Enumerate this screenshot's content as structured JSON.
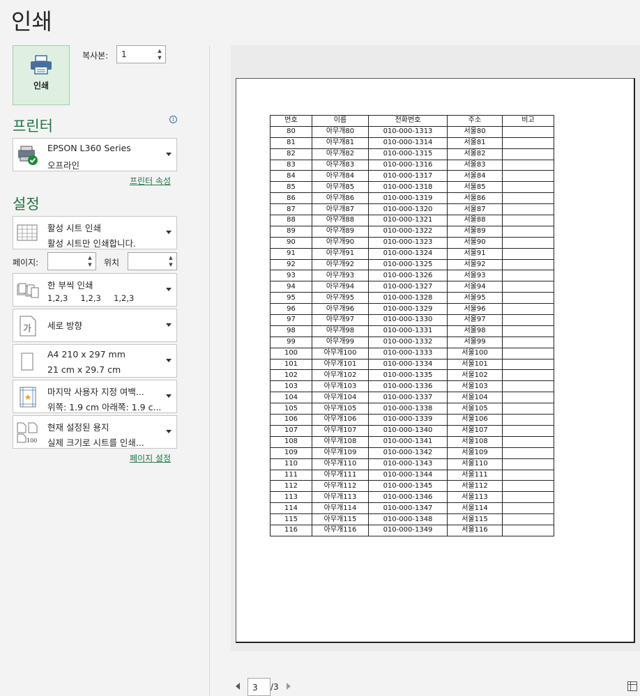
{
  "title": "인쇄",
  "print_button": {
    "label": "인쇄"
  },
  "copies": {
    "label": "복사본:",
    "value": "1"
  },
  "printer": {
    "heading": "프린터",
    "name": "EPSON L360 Series",
    "status": "오프라인",
    "properties_link": "프린터 속성"
  },
  "settings": {
    "heading": "설정",
    "scope": {
      "title": "활성 시트 인쇄",
      "desc": "활성 시트만 인쇄합니다."
    },
    "pages": {
      "label": "페이지:",
      "from": "",
      "to_label": "위치",
      "to": ""
    },
    "collate": {
      "title": "한 부씩 인쇄",
      "desc": "1,2,3     1,2,3     1,2,3"
    },
    "orientation": {
      "title": "세로 방향"
    },
    "paper": {
      "title": "A4 210 x 297 mm",
      "desc": "21 cm x 29.7 cm"
    },
    "margins": {
      "title": "마지막 사용자 지정 여백...",
      "desc": "위쪽: 1.9 cm 아래쪽: 1.9 c..."
    },
    "scaling": {
      "title": "현재 설정된 용지",
      "desc": "실제 크기로 시트를 인쇄..."
    },
    "page_setup_link": "페이지 설정"
  },
  "preview": {
    "columns": [
      "번호",
      "이름",
      "전화번호",
      "주소",
      "비고"
    ],
    "rows": [
      [
        "80",
        "아무개80",
        "010-000-1313",
        "서울80",
        ""
      ],
      [
        "81",
        "아무개81",
        "010-000-1314",
        "서울81",
        ""
      ],
      [
        "82",
        "아무개82",
        "010-000-1315",
        "서울82",
        ""
      ],
      [
        "83",
        "아무개83",
        "010-000-1316",
        "서울83",
        ""
      ],
      [
        "84",
        "아무개84",
        "010-000-1317",
        "서울84",
        ""
      ],
      [
        "85",
        "아무개85",
        "010-000-1318",
        "서울85",
        ""
      ],
      [
        "86",
        "아무개86",
        "010-000-1319",
        "서울86",
        ""
      ],
      [
        "87",
        "아무개87",
        "010-000-1320",
        "서울87",
        ""
      ],
      [
        "88",
        "아무개88",
        "010-000-1321",
        "서울88",
        ""
      ],
      [
        "89",
        "아무개89",
        "010-000-1322",
        "서울89",
        ""
      ],
      [
        "90",
        "아무개90",
        "010-000-1323",
        "서울90",
        ""
      ],
      [
        "91",
        "아무개91",
        "010-000-1324",
        "서울91",
        ""
      ],
      [
        "92",
        "아무개92",
        "010-000-1325",
        "서울92",
        ""
      ],
      [
        "93",
        "아무개93",
        "010-000-1326",
        "서울93",
        ""
      ],
      [
        "94",
        "아무개94",
        "010-000-1327",
        "서울94",
        ""
      ],
      [
        "95",
        "아무개95",
        "010-000-1328",
        "서울95",
        ""
      ],
      [
        "96",
        "아무개96",
        "010-000-1329",
        "서울96",
        ""
      ],
      [
        "97",
        "아무개97",
        "010-000-1330",
        "서울97",
        ""
      ],
      [
        "98",
        "아무개98",
        "010-000-1331",
        "서울98",
        ""
      ],
      [
        "99",
        "아무개99",
        "010-000-1332",
        "서울99",
        ""
      ],
      [
        "100",
        "아무개100",
        "010-000-1333",
        "서울100",
        ""
      ],
      [
        "101",
        "아무개101",
        "010-000-1334",
        "서울101",
        ""
      ],
      [
        "102",
        "아무개102",
        "010-000-1335",
        "서울102",
        ""
      ],
      [
        "103",
        "아무개103",
        "010-000-1336",
        "서울103",
        ""
      ],
      [
        "104",
        "아무개104",
        "010-000-1337",
        "서울104",
        ""
      ],
      [
        "105",
        "아무개105",
        "010-000-1338",
        "서울105",
        ""
      ],
      [
        "106",
        "아무개106",
        "010-000-1339",
        "서울106",
        ""
      ],
      [
        "107",
        "아무개107",
        "010-000-1340",
        "서울107",
        ""
      ],
      [
        "108",
        "아무개108",
        "010-000-1341",
        "서울108",
        ""
      ],
      [
        "109",
        "아무개109",
        "010-000-1342",
        "서울109",
        ""
      ],
      [
        "110",
        "아무개110",
        "010-000-1343",
        "서울110",
        ""
      ],
      [
        "111",
        "아무개111",
        "010-000-1344",
        "서울111",
        ""
      ],
      [
        "112",
        "아무개112",
        "010-000-1345",
        "서울112",
        ""
      ],
      [
        "113",
        "아무개113",
        "010-000-1346",
        "서울113",
        ""
      ],
      [
        "114",
        "아무개114",
        "010-000-1347",
        "서울114",
        ""
      ],
      [
        "115",
        "아무개115",
        "010-000-1348",
        "서울115",
        ""
      ],
      [
        "116",
        "아무개116",
        "010-000-1349",
        "서울116",
        ""
      ]
    ],
    "current_page": "3",
    "total_pages": "/3"
  },
  "colors": {
    "accent": "#217346",
    "button_bg": "#dff0e3"
  },
  "icons": [
    "printer-icon",
    "info-icon",
    "printer-device-icon",
    "sheet-grid-icon",
    "collate-icon",
    "portrait-icon",
    "paper-icon",
    "margins-icon",
    "scaling-icon",
    "prev-page-icon",
    "next-page-icon",
    "show-margins-icon"
  ]
}
